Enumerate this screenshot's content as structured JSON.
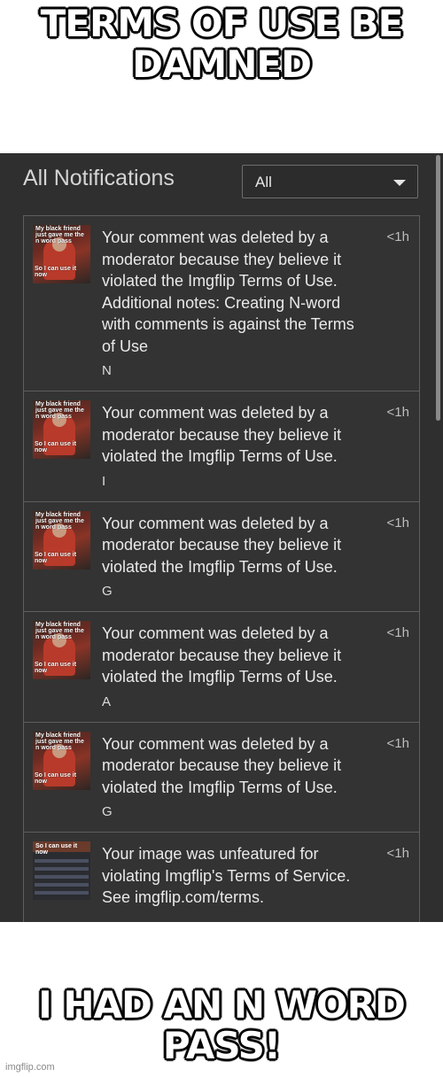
{
  "meme": {
    "top_text": "TERMS OF USE BE DAMNED",
    "bottom_text": "I HAD AN N WORD PASS!",
    "watermark": "imgflip.com"
  },
  "screen": {
    "title": "All Notifications",
    "filter": {
      "selected": "All"
    },
    "notifications": [
      {
        "thumb_top": "My black friend just gave me the n word pass",
        "thumb_bottom": "So I can use it now",
        "message": "Your comment was deleted by a moderator because they believe it violated the Imgflip Terms of Use. Additional notes: Creating N-word with comments is against the Terms of Use",
        "time": "<1h",
        "snippet": "N"
      },
      {
        "thumb_top": "My black friend just gave me the n word pass",
        "thumb_bottom": "So I can use it now",
        "message": "Your comment was deleted by a moderator because they believe it violated the Imgflip Terms of Use.",
        "time": "<1h",
        "snippet": "I"
      },
      {
        "thumb_top": "My black friend just gave me the n word pass",
        "thumb_bottom": "So I can use it now",
        "message": "Your comment was deleted by a moderator because they believe it violated the Imgflip Terms of Use.",
        "time": "<1h",
        "snippet": "G"
      },
      {
        "thumb_top": "My black friend just gave me the n word pass",
        "thumb_bottom": "So I can use it now",
        "message": "Your comment was deleted by a moderator because they believe it violated the Imgflip Terms of Use.",
        "time": "<1h",
        "snippet": "A"
      },
      {
        "thumb_top": "My black friend just gave me the n word pass",
        "thumb_bottom": "So I can use it now",
        "message": "Your comment was deleted by a moderator because they believe it violated the Imgflip Terms of Use.",
        "time": "<1h",
        "snippet": "G"
      },
      {
        "thumb_top": "So I can use it now",
        "thumb_bottom": "",
        "message": "Your image was unfeatured for violating Imgflip's Terms of Service. See imgflip.com/terms.",
        "time": "<1h",
        "snippet": ""
      }
    ]
  },
  "colors": {
    "panel_bg": "#2f2f2f",
    "card_border": "#5e5e5e",
    "text": "#e9e9e9"
  }
}
